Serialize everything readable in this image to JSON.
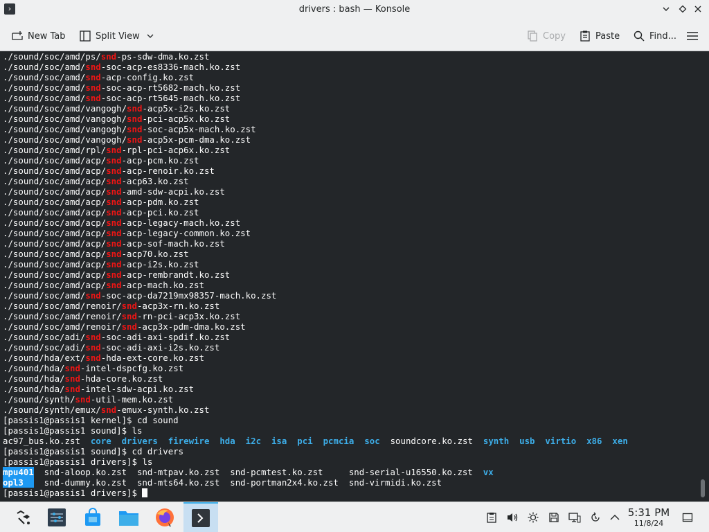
{
  "window": {
    "title": "drivers : bash — Konsole"
  },
  "toolbar": {
    "new_tab": "New Tab",
    "split_view": "Split View",
    "copy": "Copy",
    "paste": "Paste",
    "find": "Find..."
  },
  "terminal": {
    "lines": [
      [
        [
          "./sound/soc/amd/ps/",
          ""
        ],
        [
          "snd",
          "red"
        ],
        [
          "-ps-sdw-dma.ko.zst",
          ""
        ]
      ],
      [
        [
          "./sound/soc/amd/",
          ""
        ],
        [
          "snd",
          "red"
        ],
        [
          "-soc-acp-es8336-mach.ko.zst",
          ""
        ]
      ],
      [
        [
          "./sound/soc/amd/",
          ""
        ],
        [
          "snd",
          "red"
        ],
        [
          "-acp-config.ko.zst",
          ""
        ]
      ],
      [
        [
          "./sound/soc/amd/",
          ""
        ],
        [
          "snd",
          "red"
        ],
        [
          "-soc-acp-rt5682-mach.ko.zst",
          ""
        ]
      ],
      [
        [
          "./sound/soc/amd/",
          ""
        ],
        [
          "snd",
          "red"
        ],
        [
          "-soc-acp-rt5645-mach.ko.zst",
          ""
        ]
      ],
      [
        [
          "./sound/soc/amd/vangogh/",
          ""
        ],
        [
          "snd",
          "red"
        ],
        [
          "-acp5x-i2s.ko.zst",
          ""
        ]
      ],
      [
        [
          "./sound/soc/amd/vangogh/",
          ""
        ],
        [
          "snd",
          "red"
        ],
        [
          "-pci-acp5x.ko.zst",
          ""
        ]
      ],
      [
        [
          "./sound/soc/amd/vangogh/",
          ""
        ],
        [
          "snd",
          "red"
        ],
        [
          "-soc-acp5x-mach.ko.zst",
          ""
        ]
      ],
      [
        [
          "./sound/soc/amd/vangogh/",
          ""
        ],
        [
          "snd",
          "red"
        ],
        [
          "-acp5x-pcm-dma.ko.zst",
          ""
        ]
      ],
      [
        [
          "./sound/soc/amd/rpl/",
          ""
        ],
        [
          "snd",
          "red"
        ],
        [
          "-rpl-pci-acp6x.ko.zst",
          ""
        ]
      ],
      [
        [
          "./sound/soc/amd/acp/",
          ""
        ],
        [
          "snd",
          "red"
        ],
        [
          "-acp-pcm.ko.zst",
          ""
        ]
      ],
      [
        [
          "./sound/soc/amd/acp/",
          ""
        ],
        [
          "snd",
          "red"
        ],
        [
          "-acp-renoir.ko.zst",
          ""
        ]
      ],
      [
        [
          "./sound/soc/amd/acp/",
          ""
        ],
        [
          "snd",
          "red"
        ],
        [
          "-acp63.ko.zst",
          ""
        ]
      ],
      [
        [
          "./sound/soc/amd/acp/",
          ""
        ],
        [
          "snd",
          "red"
        ],
        [
          "-amd-sdw-acpi.ko.zst",
          ""
        ]
      ],
      [
        [
          "./sound/soc/amd/acp/",
          ""
        ],
        [
          "snd",
          "red"
        ],
        [
          "-acp-pdm.ko.zst",
          ""
        ]
      ],
      [
        [
          "./sound/soc/amd/acp/",
          ""
        ],
        [
          "snd",
          "red"
        ],
        [
          "-acp-pci.ko.zst",
          ""
        ]
      ],
      [
        [
          "./sound/soc/amd/acp/",
          ""
        ],
        [
          "snd",
          "red"
        ],
        [
          "-acp-legacy-mach.ko.zst",
          ""
        ]
      ],
      [
        [
          "./sound/soc/amd/acp/",
          ""
        ],
        [
          "snd",
          "red"
        ],
        [
          "-acp-legacy-common.ko.zst",
          ""
        ]
      ],
      [
        [
          "./sound/soc/amd/acp/",
          ""
        ],
        [
          "snd",
          "red"
        ],
        [
          "-acp-sof-mach.ko.zst",
          ""
        ]
      ],
      [
        [
          "./sound/soc/amd/acp/",
          ""
        ],
        [
          "snd",
          "red"
        ],
        [
          "-acp70.ko.zst",
          ""
        ]
      ],
      [
        [
          "./sound/soc/amd/acp/",
          ""
        ],
        [
          "snd",
          "red"
        ],
        [
          "-acp-i2s.ko.zst",
          ""
        ]
      ],
      [
        [
          "./sound/soc/amd/acp/",
          ""
        ],
        [
          "snd",
          "red"
        ],
        [
          "-acp-rembrandt.ko.zst",
          ""
        ]
      ],
      [
        [
          "./sound/soc/amd/acp/",
          ""
        ],
        [
          "snd",
          "red"
        ],
        [
          "-acp-mach.ko.zst",
          ""
        ]
      ],
      [
        [
          "./sound/soc/amd/",
          ""
        ],
        [
          "snd",
          "red"
        ],
        [
          "-soc-acp-da7219mx98357-mach.ko.zst",
          ""
        ]
      ],
      [
        [
          "./sound/soc/amd/renoir/",
          ""
        ],
        [
          "snd",
          "red"
        ],
        [
          "-acp3x-rn.ko.zst",
          ""
        ]
      ],
      [
        [
          "./sound/soc/amd/renoir/",
          ""
        ],
        [
          "snd",
          "red"
        ],
        [
          "-rn-pci-acp3x.ko.zst",
          ""
        ]
      ],
      [
        [
          "./sound/soc/amd/renoir/",
          ""
        ],
        [
          "snd",
          "red"
        ],
        [
          "-acp3x-pdm-dma.ko.zst",
          ""
        ]
      ],
      [
        [
          "./sound/soc/adi/",
          ""
        ],
        [
          "snd",
          "red"
        ],
        [
          "-soc-adi-axi-spdif.ko.zst",
          ""
        ]
      ],
      [
        [
          "./sound/soc/adi/",
          ""
        ],
        [
          "snd",
          "red"
        ],
        [
          "-soc-adi-axi-i2s.ko.zst",
          ""
        ]
      ],
      [
        [
          "./sound/hda/ext/",
          ""
        ],
        [
          "snd",
          "red"
        ],
        [
          "-hda-ext-core.ko.zst",
          ""
        ]
      ],
      [
        [
          "./sound/hda/",
          ""
        ],
        [
          "snd",
          "red"
        ],
        [
          "-intel-dspcfg.ko.zst",
          ""
        ]
      ],
      [
        [
          "./sound/hda/",
          ""
        ],
        [
          "snd",
          "red"
        ],
        [
          "-hda-core.ko.zst",
          ""
        ]
      ],
      [
        [
          "./sound/hda/",
          ""
        ],
        [
          "snd",
          "red"
        ],
        [
          "-intel-sdw-acpi.ko.zst",
          ""
        ]
      ],
      [
        [
          "./sound/synth/",
          ""
        ],
        [
          "snd",
          "red"
        ],
        [
          "-util-mem.ko.zst",
          ""
        ]
      ],
      [
        [
          "./sound/synth/emux/",
          ""
        ],
        [
          "snd",
          "red"
        ],
        [
          "-emux-synth.ko.zst",
          ""
        ]
      ],
      [
        [
          "[passis1@passis1 kernel]$ cd sound",
          ""
        ]
      ],
      [
        [
          "[passis1@passis1 sound]$ ls",
          ""
        ]
      ],
      [
        [
          "ac97_bus.ko.zst  ",
          ""
        ],
        [
          "core",
          "blue"
        ],
        [
          "  ",
          ""
        ],
        [
          "drivers",
          "blue"
        ],
        [
          "  ",
          ""
        ],
        [
          "firewire",
          "blue"
        ],
        [
          "  ",
          ""
        ],
        [
          "hda",
          "blue"
        ],
        [
          "  ",
          ""
        ],
        [
          "i2c",
          "blue"
        ],
        [
          "  ",
          ""
        ],
        [
          "isa",
          "blue"
        ],
        [
          "  ",
          ""
        ],
        [
          "pci",
          "blue"
        ],
        [
          "  ",
          ""
        ],
        [
          "pcmcia",
          "blue"
        ],
        [
          "  ",
          ""
        ],
        [
          "soc",
          "blue"
        ],
        [
          "  soundcore.ko.zst  ",
          ""
        ],
        [
          "synth",
          "blue"
        ],
        [
          "  ",
          ""
        ],
        [
          "usb",
          "blue"
        ],
        [
          "  ",
          ""
        ],
        [
          "virtio",
          "blue"
        ],
        [
          "  ",
          ""
        ],
        [
          "x86",
          "blue"
        ],
        [
          "  ",
          ""
        ],
        [
          "xen",
          "blue"
        ]
      ],
      [
        [
          "[passis1@passis1 sound]$ cd drivers",
          ""
        ]
      ],
      [
        [
          "[passis1@passis1 drivers]$ ls",
          ""
        ]
      ],
      [
        [
          "mpu401",
          "hl"
        ],
        [
          "  snd-aloop.ko.zst  snd-mtpav.ko.zst  snd-pcmtest.ko.zst     snd-serial-u16550.ko.zst  ",
          ""
        ],
        [
          "vx",
          "blue"
        ]
      ],
      [
        [
          "opl3  ",
          "hl"
        ],
        [
          "  snd-dummy.ko.zst  snd-mts64.ko.zst  snd-portman2x4.ko.zst  snd-virmidi.ko.zst",
          ""
        ]
      ],
      [
        [
          "[passis1@passis1 drivers]$ ",
          ""
        ],
        [
          "",
          "cursor"
        ]
      ]
    ]
  },
  "taskbar": {
    "time": "5:31 PM",
    "date": "11/8/24"
  },
  "colors": {
    "terminal_bg": "#232629",
    "red": "#ed1515",
    "blue": "#3daee9",
    "highlight": "#1d99f3"
  }
}
